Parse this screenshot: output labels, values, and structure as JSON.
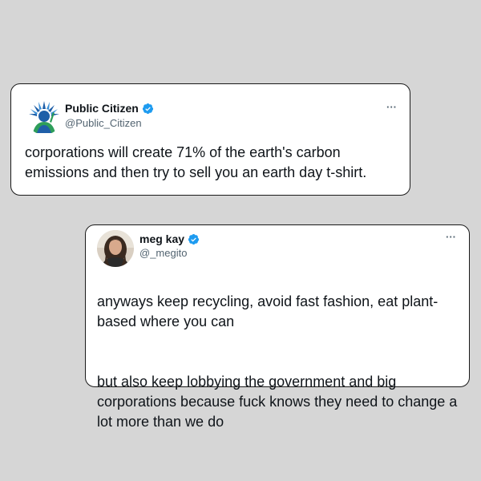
{
  "background_color": "#d6d6d6",
  "verified_color": "#1d9bf0",
  "tweets": [
    {
      "avatar_icon": "statue-of-liberty-logo",
      "display_name": "Public Citizen",
      "handle": "@Public_Citizen",
      "more_label": "···",
      "text": "corporations will create 71% of the earth's carbon emissions and then try to sell you an earth day t-shirt."
    },
    {
      "avatar_icon": "profile-photo",
      "display_name": "meg kay",
      "handle": "@_megito",
      "more_label": "···",
      "paragraphs": [
        "anyways keep recycling, avoid fast fashion, eat plant-based where you can",
        "but also keep lobbying the government and big corporations because fuck knows they need to change a lot more than we do"
      ]
    }
  ]
}
